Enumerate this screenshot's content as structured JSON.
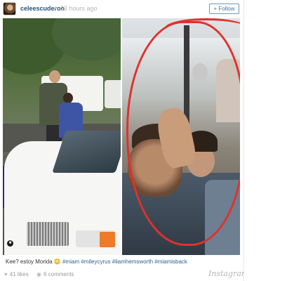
{
  "post": {
    "username": "celeescuderoo",
    "separator": "•",
    "timestamp": "23 hours ago",
    "follow_label": "+ Follow",
    "caption_text": "Kee? estoy Morida 😳 ",
    "caption_tags": "#miam #mileycyrus #liamhemsworth #miamisback",
    "likes": "41 likes",
    "comments": "6 comments",
    "logo": "Instagram"
  },
  "icons": {
    "avatar": "profile-avatar",
    "heart": "♥",
    "bubble": "💬",
    "badge": "instagram-badge-icon"
  },
  "colors": {
    "link": "#3f729b",
    "annotation": "#e0312d"
  }
}
